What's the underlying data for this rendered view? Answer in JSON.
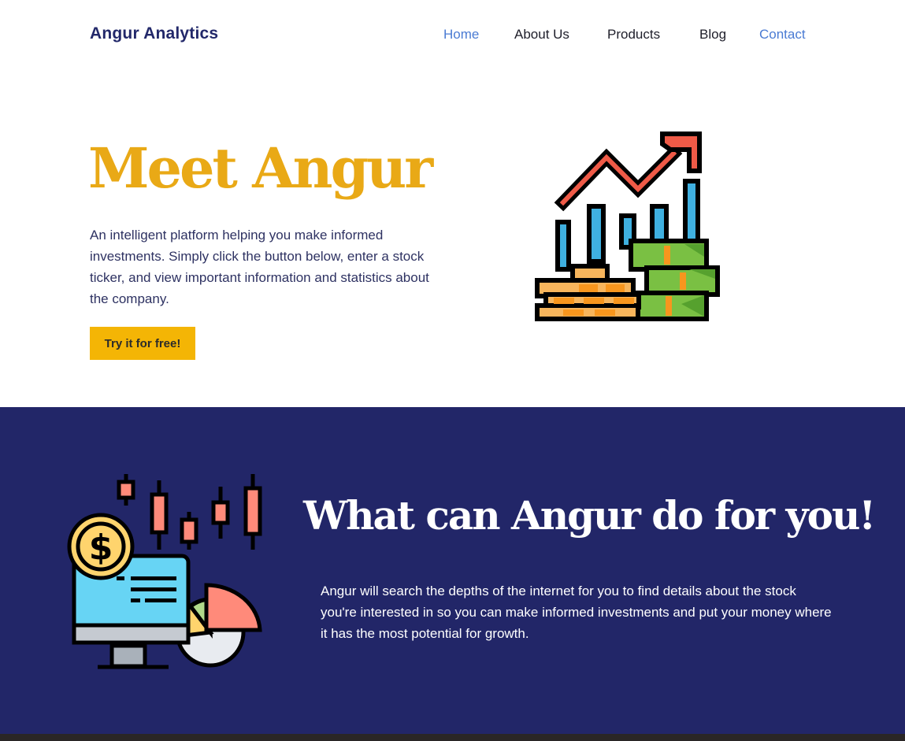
{
  "nav": {
    "brand": "Angur Analytics",
    "links": [
      {
        "label": "Home",
        "color": "#4a7bd3"
      },
      {
        "label": "About Us",
        "color": "#1e1e2a"
      },
      {
        "label": "Products",
        "color": "#1e1e2a"
      },
      {
        "label": "Blog",
        "color": "#1e1e2a"
      },
      {
        "label": "Contact",
        "color": "#4a7bd3"
      }
    ]
  },
  "hero": {
    "title": "Meet Angur",
    "description": "An intelligent platform helping you make informed investments. Simply click the button below, enter a stock ticker, and view important information and statistics about the company.",
    "cta_label": "Try it for free!",
    "illustration_icon": "growth-chart-money-icon"
  },
  "feature": {
    "title": "What can Angur do for you!",
    "description": "Angur will search the depths of the internet for you to find details about the stock you're interested in so you can make informed investments and put your money where it has the most potential for growth.",
    "illustration_icon": "trading-monitor-icon"
  },
  "colors": {
    "brand_navy": "#222668",
    "accent_gold": "#f4b505",
    "title_gold": "#e9a916",
    "link_blue": "#4a7bd3"
  }
}
